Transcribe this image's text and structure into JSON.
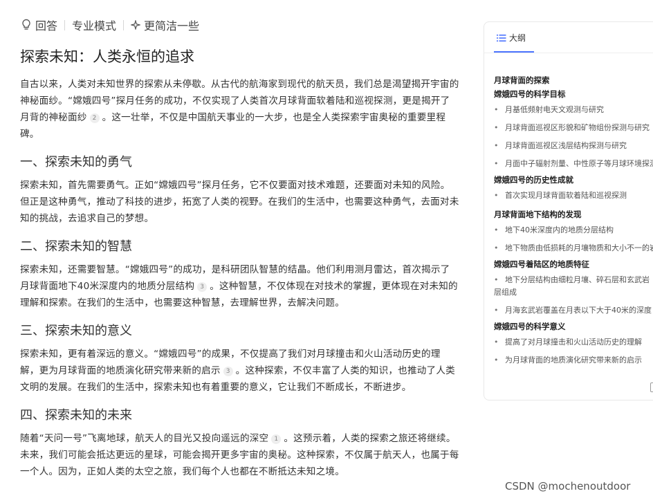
{
  "modes": {
    "answer": "回答",
    "pro": "专业模式",
    "concise": "更简洁一些"
  },
  "article": {
    "title": "探索未知：人类永恒的追求",
    "intro_a": "自古以来，人类对未知世界的探索从未停歇。从古代的航海家到现代的航天员，我们总是渴望揭开宇宙的神秘面纱。“嫦娥四号”探月任务的成功，不仅实现了人类首次月球背面软着陆和巡视探测，更是揭开了月背的神秘面纱",
    "intro_cite": "2",
    "intro_b": "。这一壮举，不仅是中国航天事业的一大步，也是全人类探索宇宙奥秘的重要里程碑。",
    "s1_title": "一、探索未知的勇气",
    "s1_text": "探索未知，首先需要勇气。正如“嫦娥四号”探月任务，它不仅要面对技术难题，还要面对未知的风险。但正是这种勇气，推动了科技的进步，拓宽了人类的视野。在我们的生活中，也需要这种勇气，去面对未知的挑战，去追求自己的梦想。",
    "s2_title": "二、探索未知的智慧",
    "s2_text_a": "探索未知，还需要智慧。“嫦娥四号”的成功，是科研团队智慧的结晶。他们利用测月雷达，首次揭示了月球背面地下40米深度内的地质分层结构",
    "s2_cite": "3",
    "s2_text_b": "。这种智慧，不仅体现在对技术的掌握，更体现在对未知的理解和探索。在我们的生活中，也需要这种智慧，去理解世界，去解决问题。",
    "s3_title": "三、探索未知的意义",
    "s3_text_a": "探索未知，更有着深远的意义。“嫦娥四号”的成果，不仅提高了我们对月球撞击和火山活动历史的理解，更为月球背面的地质演化研究带来新的启示",
    "s3_cite": "3",
    "s3_text_b": "。这种探索，不仅丰富了人类的知识，也推动了人类文明的发展。在我们的生活中，探索未知也有着重要的意义，它让我们不断成长，不断进步。",
    "s4_title": "四、探索未知的未来",
    "s4_text_a": "随着“天问一号”飞离地球，航天人的目光又投向遥远的深空",
    "s4_cite": "1",
    "s4_text_b": "。这预示着，人类的探索之旅还将继续。未来，我们可能会抵达更远的星球，可能会揭开更多宇宙的奥秘。这种探索，不仅属于航天人，也属于每一个人。因为，正如人类的太空之旅，我们每个人也都在不断抵达未知之境。"
  },
  "outline": {
    "tab_label": "大纲",
    "sec1": "月球背面的探索",
    "sec1_sub": "嫦娥四号的科学目标",
    "sec1_items": [
      "月基低频射电天文观测与研究",
      "月球背面巡视区形貌和矿物组份探测与研究",
      "月球背面巡视区浅层结构探测与研究",
      "月面中子辐射剂量、中性原子等月球环境探测研究"
    ],
    "sec2": "嫦娥四号的历史性成就",
    "sec2_items": [
      "首次实现月球背面软着陆和巡视探测"
    ],
    "sec3": "月球背面地下结构的发现",
    "sec3_items": [
      "地下40米深度内的地质分层结构",
      "地下物质由低损耗的月壤物质和大小不一的岩石组成"
    ],
    "sec4": "嫦娥四号着陆区的地质特征",
    "sec4_item_wrap": "地下分层结构由细粒月壤、碎石层和玄武岩层组成",
    "sec4_items": [
      "月海玄武岩覆盖在月表以下大于40米的深度"
    ],
    "sec5": "嫦娥四号的科学意义",
    "sec5_items": [
      "提高了对月球撞击和火山活动历史的理解",
      "为月球背面的地质演化研究带来新的启示"
    ]
  },
  "watermark": "CSDN @mochenoutdoor",
  "colors": {
    "accent": "#4a72ff"
  }
}
